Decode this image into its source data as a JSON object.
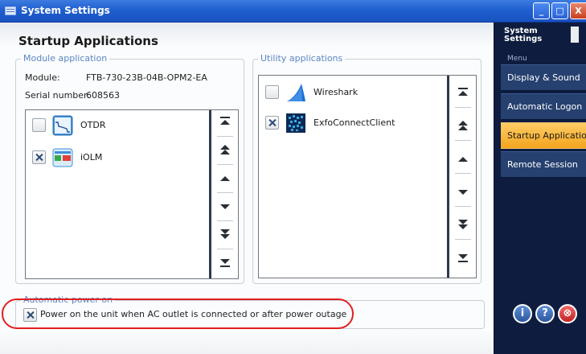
{
  "window": {
    "title": "System Settings",
    "controls": {
      "minimize": "_",
      "maximize": "□",
      "close": "X"
    }
  },
  "page": {
    "title": "Startup Applications"
  },
  "module_group": {
    "legend": "Module application",
    "module_label": "Module:",
    "module_value": "FTB-730-23B-04B-OPM2-EA",
    "serial_label": "Serial number:",
    "serial_value": "608563",
    "items": [
      {
        "label": "OTDR",
        "checked": false,
        "icon": "otdr-icon"
      },
      {
        "label": "iOLM",
        "checked": true,
        "icon": "iolm-icon"
      }
    ]
  },
  "utility_group": {
    "legend": "Utility applications",
    "items": [
      {
        "label": "Wireshark",
        "checked": false,
        "icon": "wireshark-icon"
      },
      {
        "label": "ExfoConnectClient",
        "checked": true,
        "icon": "exfoconnect-icon"
      }
    ]
  },
  "scroll_buttons": [
    "move-to-top",
    "page-up",
    "move-up",
    "move-down",
    "page-down",
    "move-to-bottom"
  ],
  "power_group": {
    "legend": "Automatic power on",
    "label": "Power on the unit when AC outlet is connected or after power outage",
    "checked": true
  },
  "sidebar": {
    "title": "System Settings",
    "menu_label": "Menu",
    "items": [
      {
        "label": "Display & Sound",
        "active": false
      },
      {
        "label": "Automatic Logon",
        "active": false
      },
      {
        "label": "Startup Applications",
        "active": true
      },
      {
        "label": "Remote Session",
        "active": false
      }
    ],
    "bottom_buttons": [
      {
        "glyph": "i",
        "icon": "info-icon"
      },
      {
        "glyph": "?",
        "icon": "help-icon"
      },
      {
        "glyph": "⊗",
        "icon": "exit-icon"
      }
    ]
  },
  "colors": {
    "titlebar": "#1f5fd0",
    "sidebar_bg": "#0e1d3f",
    "sidebar_item": "#26406f",
    "active_item": "#f4a51d",
    "legend_text": "#5a86c4",
    "highlight_ring": "#e0201f"
  }
}
